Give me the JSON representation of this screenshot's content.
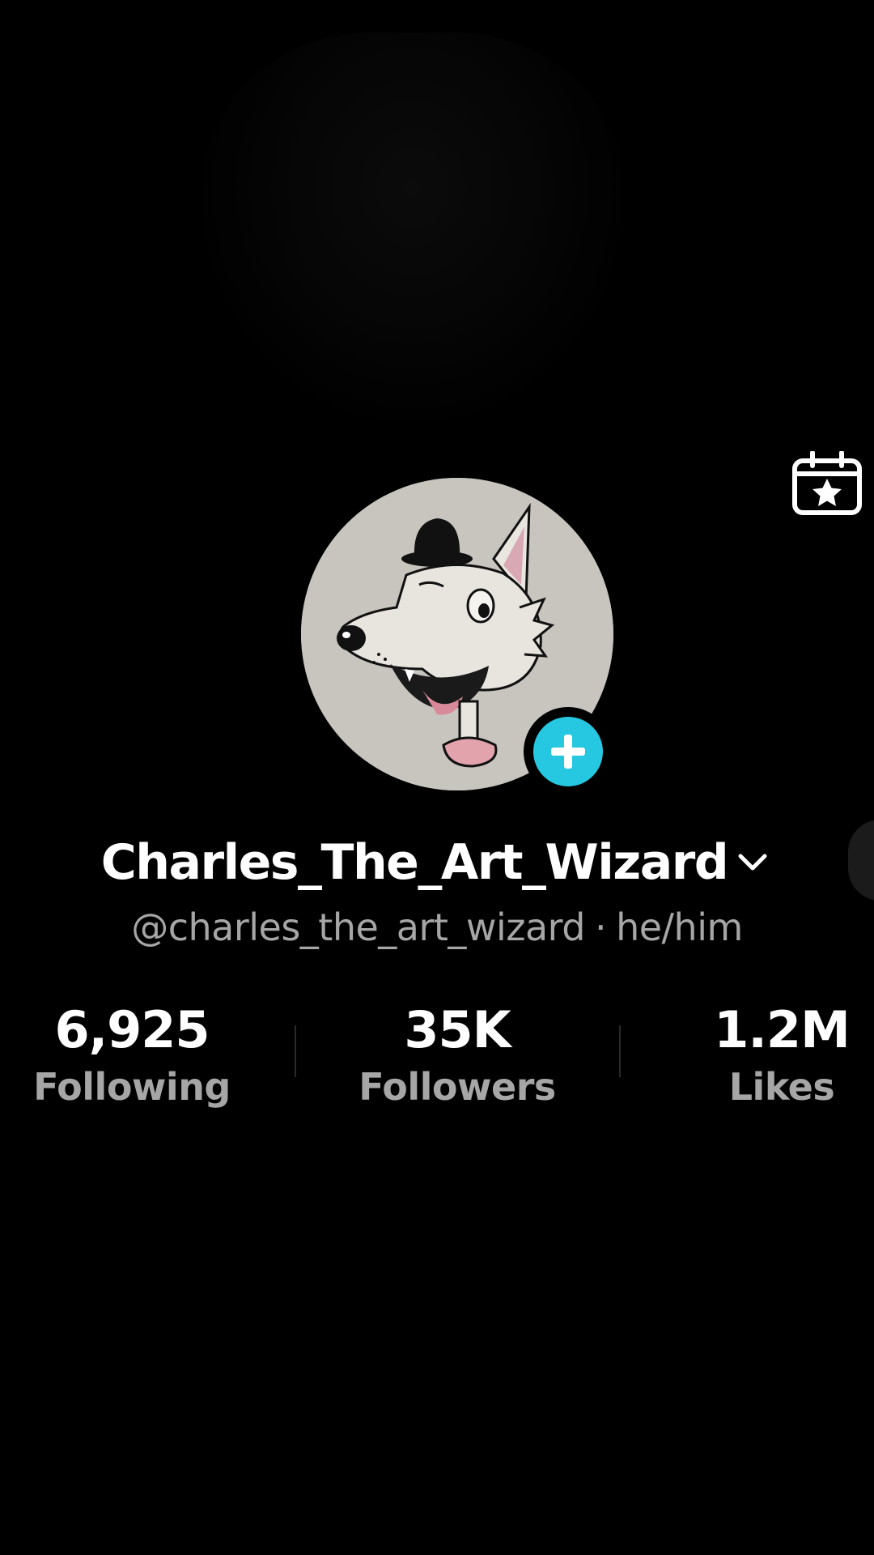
{
  "profile": {
    "display_name": "Charles_The_Art_Wizard",
    "username": "@charles_the_art_wizard",
    "separator": "·",
    "pronouns": "he/him"
  },
  "stats": [
    {
      "value": "6,925",
      "label": "Following"
    },
    {
      "value": "35K",
      "label": "Followers"
    },
    {
      "value": "1.2M",
      "label": "Likes"
    }
  ],
  "icons": {
    "calendar": "calendar-star-icon",
    "follow": "plus-icon",
    "name_dropdown": "chevron-down-icon"
  },
  "colors": {
    "background": "#000000",
    "follow_accent": "#25c8e0",
    "secondary_text": "#a6a6a6"
  }
}
